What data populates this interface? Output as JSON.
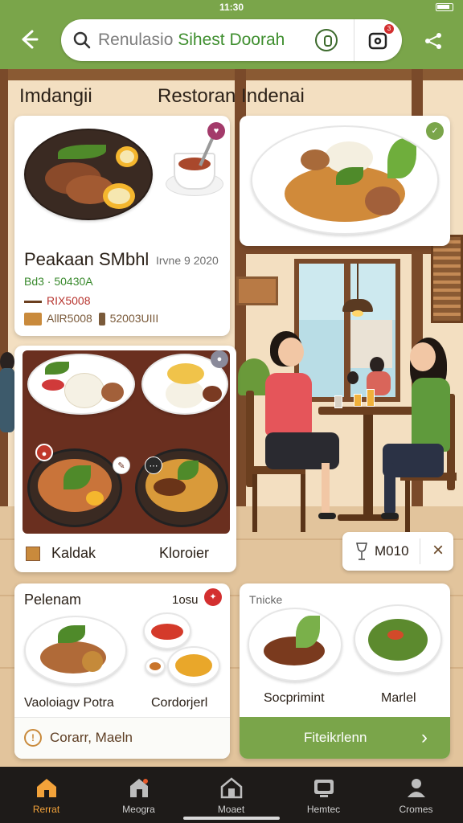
{
  "status": {
    "time": "11:30"
  },
  "header": {
    "search_query_prefix": "Renulasio",
    "search_query_main": "Sihest Doorah",
    "cart_count": "3"
  },
  "sections": {
    "left_title": "Imdangii",
    "right_title": "Restoran Indenai"
  },
  "card_featured": {
    "name": "Peakaan SMbhl",
    "date": "Irvne 9 2020",
    "row1": "Bd3 · 50430A",
    "row2": "RIX5008",
    "row3_left": "AllR5008",
    "row3_right": "52003UIII"
  },
  "card_combo": {
    "label_left": "Kaldak",
    "label_right": "Kloroier"
  },
  "overlay_chip": {
    "text": "M010",
    "close": "×"
  },
  "card_pelenam": {
    "title": "Pelenam",
    "count": "1osu",
    "caption_left": "Vaoloiagv Potra",
    "caption_right": "Cordorjerl",
    "footer": "Corarr, Maeln"
  },
  "card_more": {
    "title": "Tnicke",
    "caption_left": "Socprimint",
    "caption_right": "Marlel",
    "cta": "Fiteikrlenn",
    "cta_arrow": "›"
  },
  "bottom_nav": [
    {
      "label": "Rerrat",
      "icon": "home-icon"
    },
    {
      "label": "Meogra",
      "icon": "store-icon"
    },
    {
      "label": "Moaet",
      "icon": "house-icon"
    },
    {
      "label": "Hemtec",
      "icon": "tv-icon"
    },
    {
      "label": "Cromes",
      "icon": "person-icon"
    }
  ],
  "colors": {
    "brand_green": "#7aa54a",
    "accent_orange": "#f2a23a",
    "badge_red": "#d32f2f"
  }
}
